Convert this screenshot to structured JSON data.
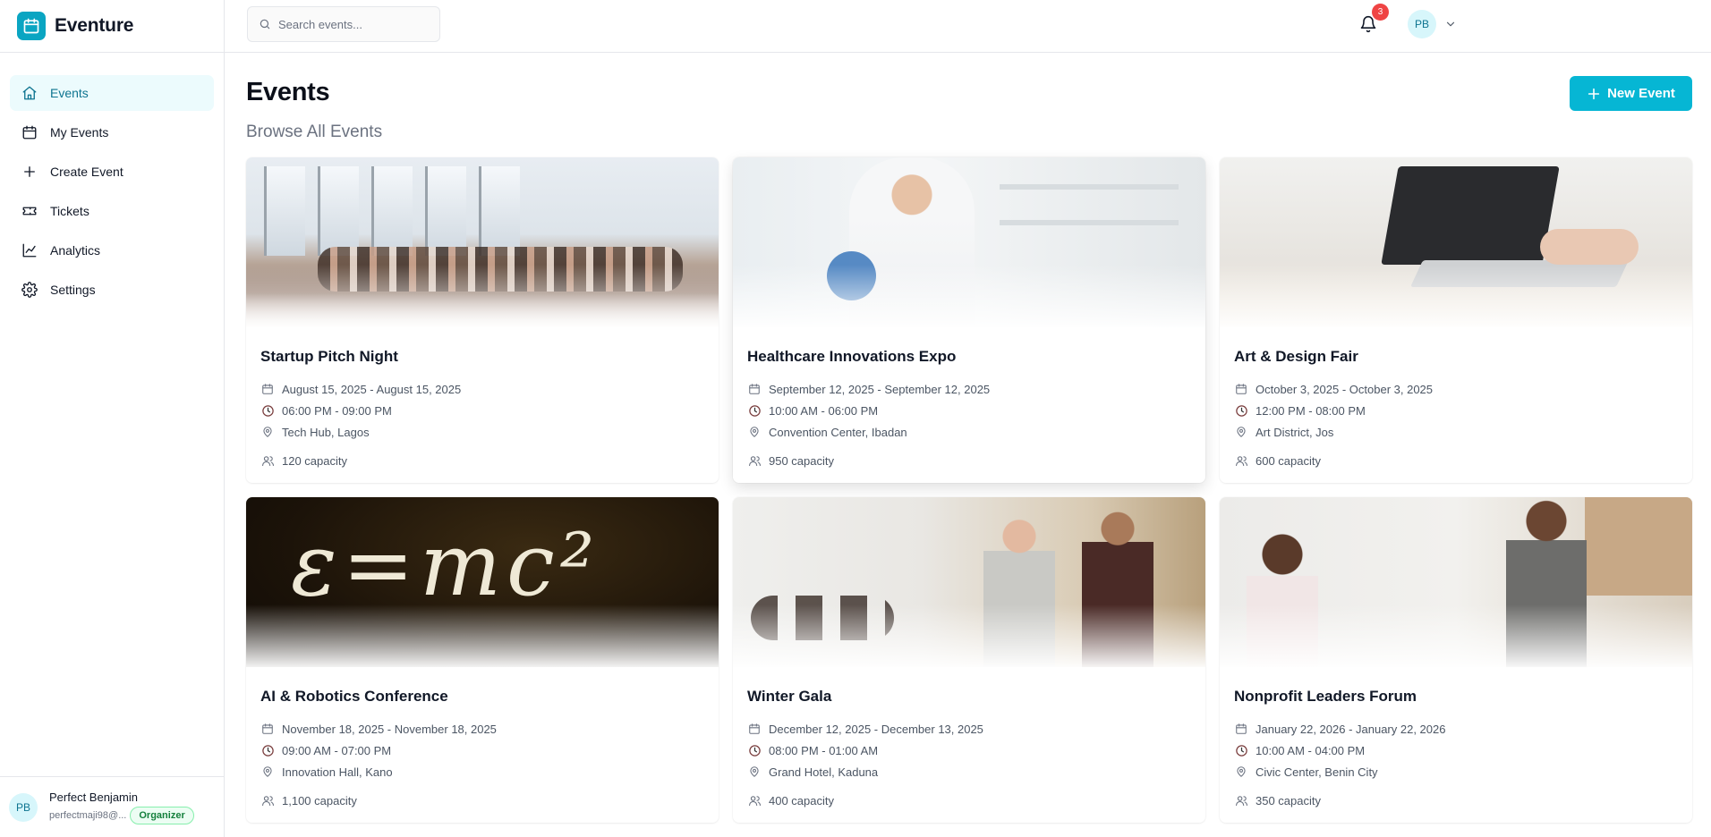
{
  "app": {
    "name": "Eventure"
  },
  "colors": {
    "accent": "#06b6d4",
    "accent_dark": "#0e7490",
    "badge_red": "#ef4444",
    "organizer_green": "#15803d"
  },
  "sidebar": {
    "items": [
      {
        "label": "Events",
        "icon": "home-icon",
        "active": true
      },
      {
        "label": "My Events",
        "icon": "calendar-icon",
        "active": false
      },
      {
        "label": "Create Event",
        "icon": "plus-icon",
        "active": false
      },
      {
        "label": "Tickets",
        "icon": "ticket-icon",
        "active": false
      },
      {
        "label": "Analytics",
        "icon": "line-chart-icon",
        "active": false
      },
      {
        "label": "Settings",
        "icon": "gear-icon",
        "active": false
      }
    ],
    "user": {
      "initials": "PB",
      "name": "Perfect Benjamin",
      "email": "perfectmaji98@...",
      "role": "Organizer"
    }
  },
  "topbar": {
    "search_placeholder": "Search events...",
    "notification_count": "3",
    "avatar_initials": "PB"
  },
  "main": {
    "title": "Events",
    "subtitle": "Browse All Events",
    "new_button_label": "New Event"
  },
  "events": [
    {
      "title": "Startup Pitch Night",
      "dates": "August 15, 2025 - August 15, 2025",
      "time": "06:00 PM - 09:00 PM",
      "location": "Tech Hub, Lagos",
      "capacity": "120 capacity"
    },
    {
      "title": "Healthcare Innovations Expo",
      "dates": "September 12, 2025 - September 12, 2025",
      "time": "10:00 AM - 06:00 PM",
      "location": "Convention Center, Ibadan",
      "capacity": "950 capacity"
    },
    {
      "title": "Art & Design Fair",
      "dates": "October 3, 2025 - October 3, 2025",
      "time": "12:00 PM - 08:00 PM",
      "location": "Art District, Jos",
      "capacity": "600 capacity"
    },
    {
      "title": "AI & Robotics Conference",
      "dates": "November 18, 2025 - November 18, 2025",
      "time": "09:00 AM - 07:00 PM",
      "location": "Innovation Hall, Kano",
      "capacity": "1,100 capacity"
    },
    {
      "title": "Winter Gala",
      "dates": "December 12, 2025 - December 13, 2025",
      "time": "08:00 PM - 01:00 AM",
      "location": "Grand Hotel, Kaduna",
      "capacity": "400 capacity"
    },
    {
      "title": "Nonprofit Leaders Forum",
      "dates": "January 22, 2026 - January 22, 2026",
      "time": "10:00 AM - 04:00 PM",
      "location": "Civic Center, Benin City",
      "capacity": "350 capacity"
    }
  ]
}
